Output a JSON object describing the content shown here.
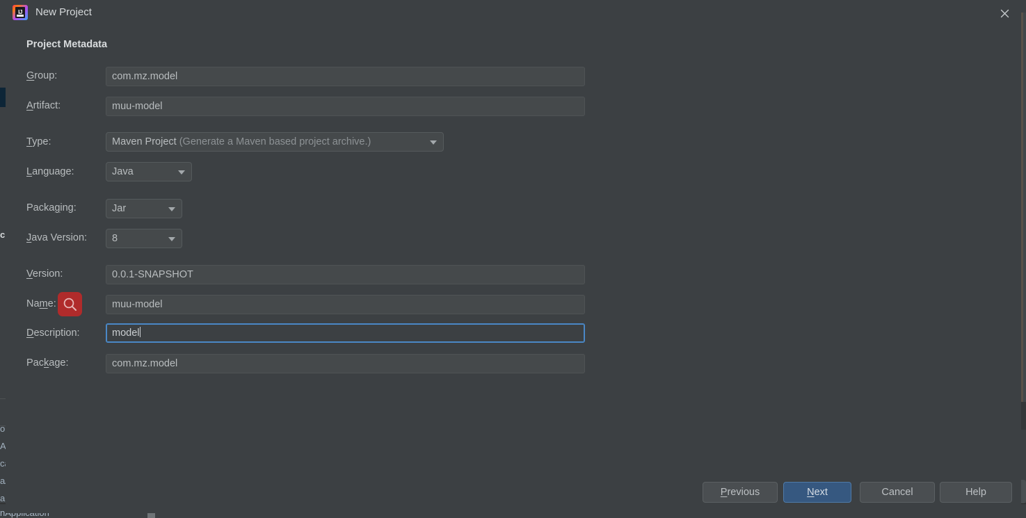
{
  "window": {
    "title": "New Project",
    "app_icon": "intellij-idea-logo",
    "close_icon": "close-icon",
    "bg_color": "#3c4043"
  },
  "section": {
    "title": "Project Metadata"
  },
  "fields": {
    "group": {
      "label_pre": "",
      "label_mn": "G",
      "label_post": "roup:",
      "value": "com.mz.model",
      "type": "text"
    },
    "artifact": {
      "label_pre": "",
      "label_mn": "A",
      "label_post": "rtifact:",
      "value": "muu-model",
      "type": "text"
    },
    "type": {
      "label_pre": "",
      "label_mn": "T",
      "label_post": "ype:",
      "value": "Maven Project",
      "hint": " (Generate a Maven based project archive.)",
      "type": "combo"
    },
    "language": {
      "label_pre": "",
      "label_mn": "L",
      "label_post": "anguage:",
      "value": "Java",
      "type": "combo"
    },
    "packaging": {
      "label_pre": "Packa",
      "label_mn": "g",
      "label_post": "ing:",
      "value": "Jar",
      "type": "combo"
    },
    "java_version": {
      "label_pre": "",
      "label_mn": "J",
      "label_post": "ava Version:",
      "value": "8",
      "type": "combo"
    },
    "version": {
      "label_pre": "",
      "label_mn": "V",
      "label_post": "ersion:",
      "value": "0.0.1-SNAPSHOT",
      "type": "text"
    },
    "name": {
      "label_pre": "Na",
      "label_mn": "m",
      "label_post": "e:",
      "value": "muu-model",
      "type": "text"
    },
    "description": {
      "label_pre": "",
      "label_mn": "D",
      "label_post": "escription:",
      "value": "model",
      "type": "text",
      "focused": true
    },
    "package": {
      "label_pre": "Pac",
      "label_mn": "k",
      "label_post": "age:",
      "value": "com.mz.model",
      "type": "text"
    }
  },
  "overlay": {
    "search_badge_icon": "search-icon",
    "search_badge_color": "#b02b2b"
  },
  "buttons": {
    "previous": {
      "pre": "",
      "mn": "P",
      "post": "revious",
      "primary": false
    },
    "next": {
      "pre": "",
      "mn": "N",
      "post": "ext",
      "primary": true
    },
    "cancel": {
      "pre": "Cancel",
      "mn": "",
      "post": "",
      "primary": false
    },
    "help": {
      "pre": "Help",
      "mn": "",
      "post": "",
      "primary": false
    }
  },
  "background_ide": {
    "fragments": [
      "ol",
      "A",
      "ca",
      "a/",
      "ai"
    ],
    "bottom_text": "nApplication"
  },
  "colors": {
    "dialog_bg": "#3c4043",
    "field_bg": "#45494b",
    "focus_blue": "#4a88c7",
    "primary_btn": "#365880",
    "text": "#b9bdbf",
    "badge_red": "#b02b2b"
  }
}
